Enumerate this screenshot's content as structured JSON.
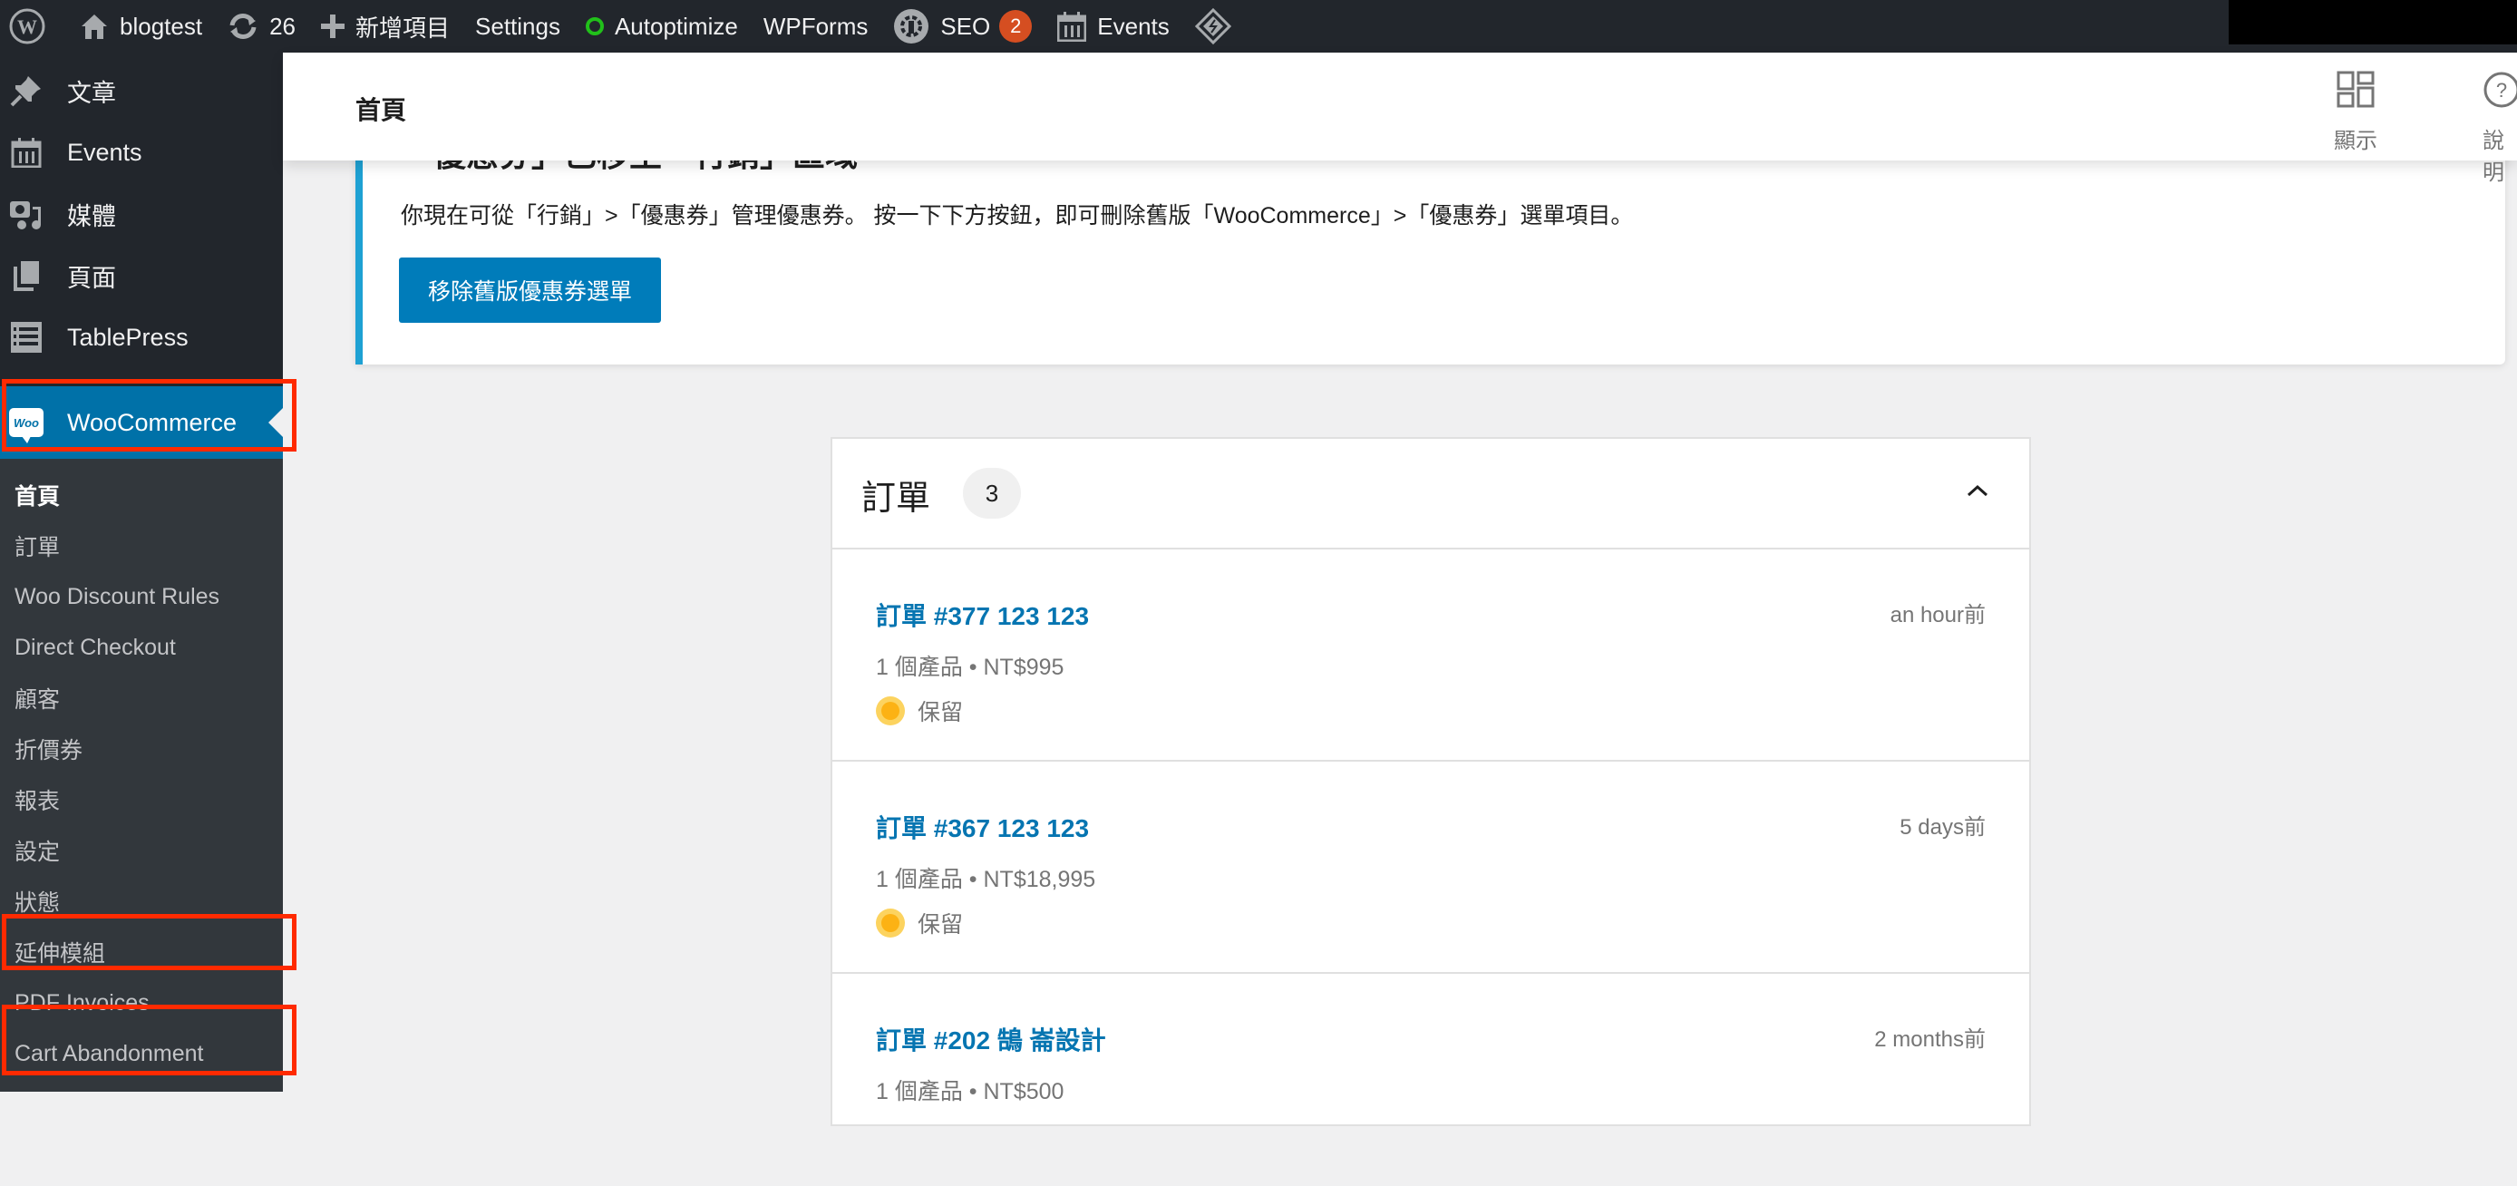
{
  "admin_bar": {
    "site_name": "blogtest",
    "updates_count": "26",
    "new_item_label": "新增項目",
    "settings_label": "Settings",
    "autoptimize_label": "Autoptimize",
    "wpforms_label": "WPForms",
    "seo_label": "SEO",
    "seo_badge": "2",
    "events_label": "Events",
    "icons": {
      "wp_logo": "wordpress-logo-icon",
      "home": "home-icon",
      "updates": "refresh-icon",
      "new": "plus-icon",
      "autoptimize": "status-circle-icon",
      "seo": "gear-plug-icon",
      "events": "calendar-icon",
      "diamond": "diamond-plugin-icon"
    },
    "colors": {
      "background": "#22262c",
      "seo_badge": "#d54e21",
      "autoptimize_status": "#21c01a"
    }
  },
  "sidebar": {
    "items": [
      {
        "label": "文章",
        "icon": "pin-icon"
      },
      {
        "label": "Events",
        "icon": "calendar-icon"
      },
      {
        "label": "媒體",
        "icon": "media-icon"
      },
      {
        "label": "頁面",
        "icon": "pages-icon"
      },
      {
        "label": "TablePress",
        "icon": "table-icon"
      }
    ],
    "active_item": {
      "label": "WooCommerce",
      "icon": "woo-logo-icon",
      "logo_text": "Woo"
    },
    "submenu": [
      {
        "label": "首頁",
        "current": true
      },
      {
        "label": "訂單"
      },
      {
        "label": "Woo Discount Rules"
      },
      {
        "label": "Direct Checkout"
      },
      {
        "label": "顧客"
      },
      {
        "label": "折價券"
      },
      {
        "label": "報表"
      },
      {
        "label": "設定"
      },
      {
        "label": "狀態"
      },
      {
        "label": "延伸模組",
        "highlighted": true
      },
      {
        "label": "PDF Invoices"
      },
      {
        "label": "Cart Abandonment",
        "highlighted": true
      }
    ],
    "colors": {
      "active": "#0071a8",
      "submenu_bg": "#32373c",
      "highlight_box": "#ff2a00"
    }
  },
  "header": {
    "title": "首頁",
    "display_label": "顯示",
    "help_label": "說明"
  },
  "notice": {
    "title": "「優惠券」已移至「行銷」區域",
    "text": "你現在可從「行銷」>「優惠券」管理優惠券。 按一下下方按鈕，即可刪除舊版「WooCommerce」>「優惠券」選單項目。",
    "button_label": "移除舊版優惠券選單",
    "colors": {
      "border": "#1ea1d3",
      "button": "#007cba"
    }
  },
  "orders": {
    "title": "訂單",
    "count": "3",
    "items": [
      {
        "link": "訂單 #377 123 123",
        "time": "an hour前",
        "meta": "1 個產品 • NT$995",
        "status": "保留"
      },
      {
        "link": "訂單 #367 123 123",
        "time": "5 days前",
        "meta": "1 個產品 • NT$18,995",
        "status": "保留"
      },
      {
        "link": "訂單 #202 鵠 崙設計",
        "time": "2 months前",
        "meta": "1 個產品 • NT$500",
        "status": ""
      }
    ],
    "colors": {
      "link": "#0675b1",
      "status_on_hold": "#fcb214"
    }
  }
}
